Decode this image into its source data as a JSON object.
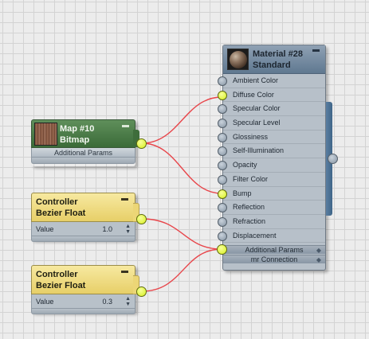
{
  "material_node": {
    "title": "Material #28",
    "subtitle": "Standard",
    "slots": [
      {
        "label": "Ambient Color",
        "active": false
      },
      {
        "label": "Diffuse Color",
        "active": true
      },
      {
        "label": "Specular Color",
        "active": false
      },
      {
        "label": "Specular Level",
        "active": false
      },
      {
        "label": "Glossiness",
        "active": false
      },
      {
        "label": "Self-Illumination",
        "active": false
      },
      {
        "label": "Opacity",
        "active": false
      },
      {
        "label": "Filter Color",
        "active": false
      },
      {
        "label": "Bump",
        "active": true
      },
      {
        "label": "Reflection",
        "active": false
      },
      {
        "label": "Refraction",
        "active": false
      },
      {
        "label": "Displacement",
        "active": false
      }
    ],
    "footer_1": "Additional Params",
    "footer_2": "mr Connection"
  },
  "map_node": {
    "title": "Map #10",
    "subtitle": "Bitmap",
    "footer": "Additional Params"
  },
  "controller_nodes": [
    {
      "title": "Controller",
      "subtitle": "Bezier Float",
      "param_label": "Value",
      "param_value": "1.0"
    },
    {
      "title": "Controller",
      "subtitle": "Bezier Float",
      "param_label": "Value",
      "param_value": "0.3"
    }
  ],
  "colors": {
    "wire": "#e8464b",
    "active_socket": "#d6ef1c",
    "material_header": "#5f7890",
    "map_header": "#3b6b38",
    "controller_header": "#e7cf68"
  }
}
